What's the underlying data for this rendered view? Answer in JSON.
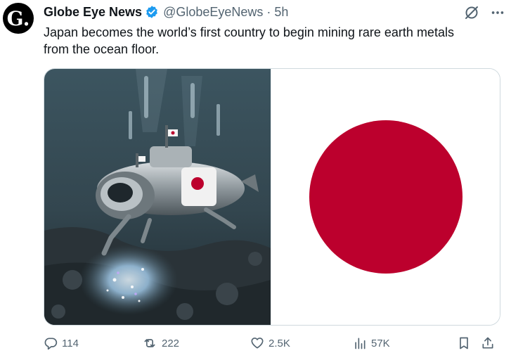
{
  "account": {
    "avatar_letter": "G.",
    "name": "Globe Eye News",
    "handle": "@GlobeEyeNews",
    "separator": "·",
    "time": "5h"
  },
  "tweet": {
    "text": "Japan becomes the world’s first country to begin mining rare earth metals\nfrom the ocean floor."
  },
  "media": {
    "left_image": "underwater-mining-submarine-with-japanese-flag",
    "right_image": "flag-of-japan",
    "flag_disc_color": "#bc002d"
  },
  "actions": {
    "replies": "114",
    "reposts": "222",
    "likes": "2.5K",
    "views": "57K"
  },
  "colors": {
    "text": "#0f1419",
    "secondary": "#536471",
    "verified": "#1d9bf0"
  }
}
